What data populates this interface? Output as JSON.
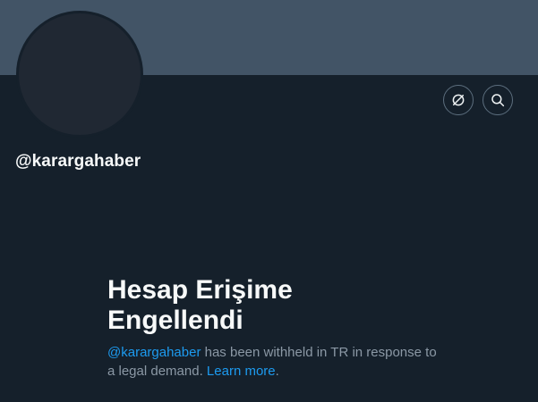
{
  "profile": {
    "handle": "@karargahaber",
    "banner_color": "#425466",
    "avatar_color": "#202833"
  },
  "toolbar": {
    "unmute_icon": "no-sync-circle-icon",
    "search_icon": "search-icon"
  },
  "withheld": {
    "title_line1": "Hesap Erişime",
    "title_line2": "Engellendi",
    "handle_link": "@karargahaber",
    "message_mid": " has been withheld in TR in response to a legal demand. ",
    "learn_more": "Learn more",
    "message_end": "."
  }
}
